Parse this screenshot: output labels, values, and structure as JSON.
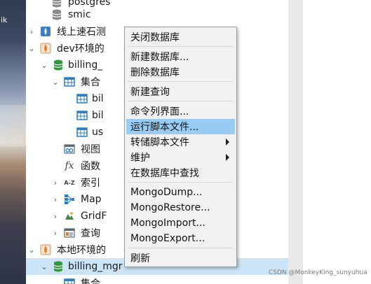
{
  "wallpaper_text": "ik",
  "tree": {
    "items": [
      {
        "label": "postgres"
      },
      {
        "label": "smic"
      },
      {
        "label": "线上速石测"
      },
      {
        "label": "dev环境的"
      },
      {
        "label": "billing_"
      },
      {
        "label": "集合"
      },
      {
        "label": "bil"
      },
      {
        "label": "bil"
      },
      {
        "label": "us"
      },
      {
        "label": "视图"
      },
      {
        "label": "函数"
      },
      {
        "label": "索引"
      },
      {
        "label": "Map"
      },
      {
        "label": "GridF"
      },
      {
        "label": "查询"
      },
      {
        "label": "本地环境的"
      },
      {
        "label": "billing_mgr"
      },
      {
        "label": "集合"
      }
    ]
  },
  "context_menu": {
    "items": [
      {
        "label": "关闭数据库"
      },
      {
        "label": "新建数据库..."
      },
      {
        "label": "删除数据库"
      },
      {
        "label": "新建查询"
      },
      {
        "label": "命令列界面..."
      },
      {
        "label": "运行脚本文件..."
      },
      {
        "label": "转储脚本文件"
      },
      {
        "label": "维护"
      },
      {
        "label": "在数据库中查找"
      },
      {
        "label": "MongoDump..."
      },
      {
        "label": "MongoRestore..."
      },
      {
        "label": "MongoImport..."
      },
      {
        "label": "MongoExport..."
      },
      {
        "label": "刷新"
      }
    ]
  },
  "watermark": "CSDN @MonkeyKing_sunyuhua",
  "colors": {
    "selection": "#cce4f7",
    "menu_highlight": "#99ccf5",
    "db_icon_green": "#2e9a3c",
    "mongo_leaf": "#e07b2a",
    "table_icon_blue": "#2f7ec4"
  }
}
